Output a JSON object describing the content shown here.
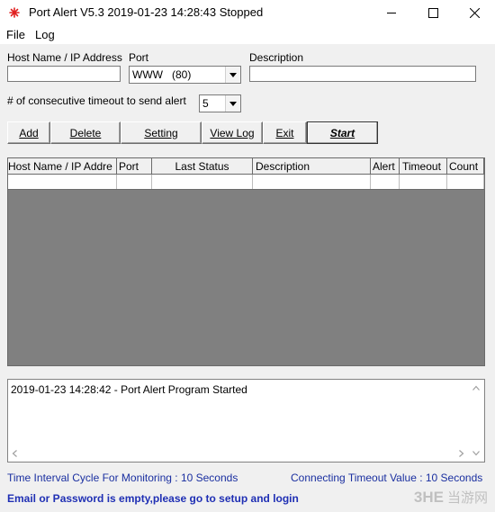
{
  "window": {
    "title": "Port Alert V5.3 2019-01-23 14:28:43 Stopped",
    "minimize_glyph": "—",
    "maximize_glyph": "☐",
    "close_glyph": "✕",
    "app_icon": "red-star-icon",
    "accent_color": "#e02020"
  },
  "menu": {
    "items": [
      {
        "label": "File"
      },
      {
        "label": "Log"
      }
    ]
  },
  "form": {
    "host_label": "Host Name / IP Address",
    "host_value": "",
    "port_label": "Port",
    "port_value": "WWW   (80)",
    "description_label": "Description",
    "description_value": "",
    "timeout_label": "# of consecutive timeout to send alert",
    "timeout_value": "5"
  },
  "buttons": {
    "add": "Add",
    "delete": "Delete",
    "setting": "Setting",
    "view_log": "View Log",
    "exit": "Exit",
    "start": "Start"
  },
  "table": {
    "columns": [
      "Host Name / IP Addre",
      "Port",
      "Last Status",
      "Description",
      "Alert",
      "Timeout",
      "Count"
    ],
    "rows": [
      [
        "",
        "",
        "",
        "",
        "",
        "",
        ""
      ]
    ]
  },
  "log": {
    "lines": [
      "2019-01-23 14:28:42 - Port Alert Program Started"
    ]
  },
  "status": {
    "interval": "Time Interval Cycle For Monitoring : 10 Seconds",
    "timeout": "Connecting Timeout Value : 10 Seconds",
    "warning": "Email or Password is empty,please go to setup and login"
  },
  "watermark": {
    "logo_text": "3HE",
    "site_text": "当游网"
  }
}
